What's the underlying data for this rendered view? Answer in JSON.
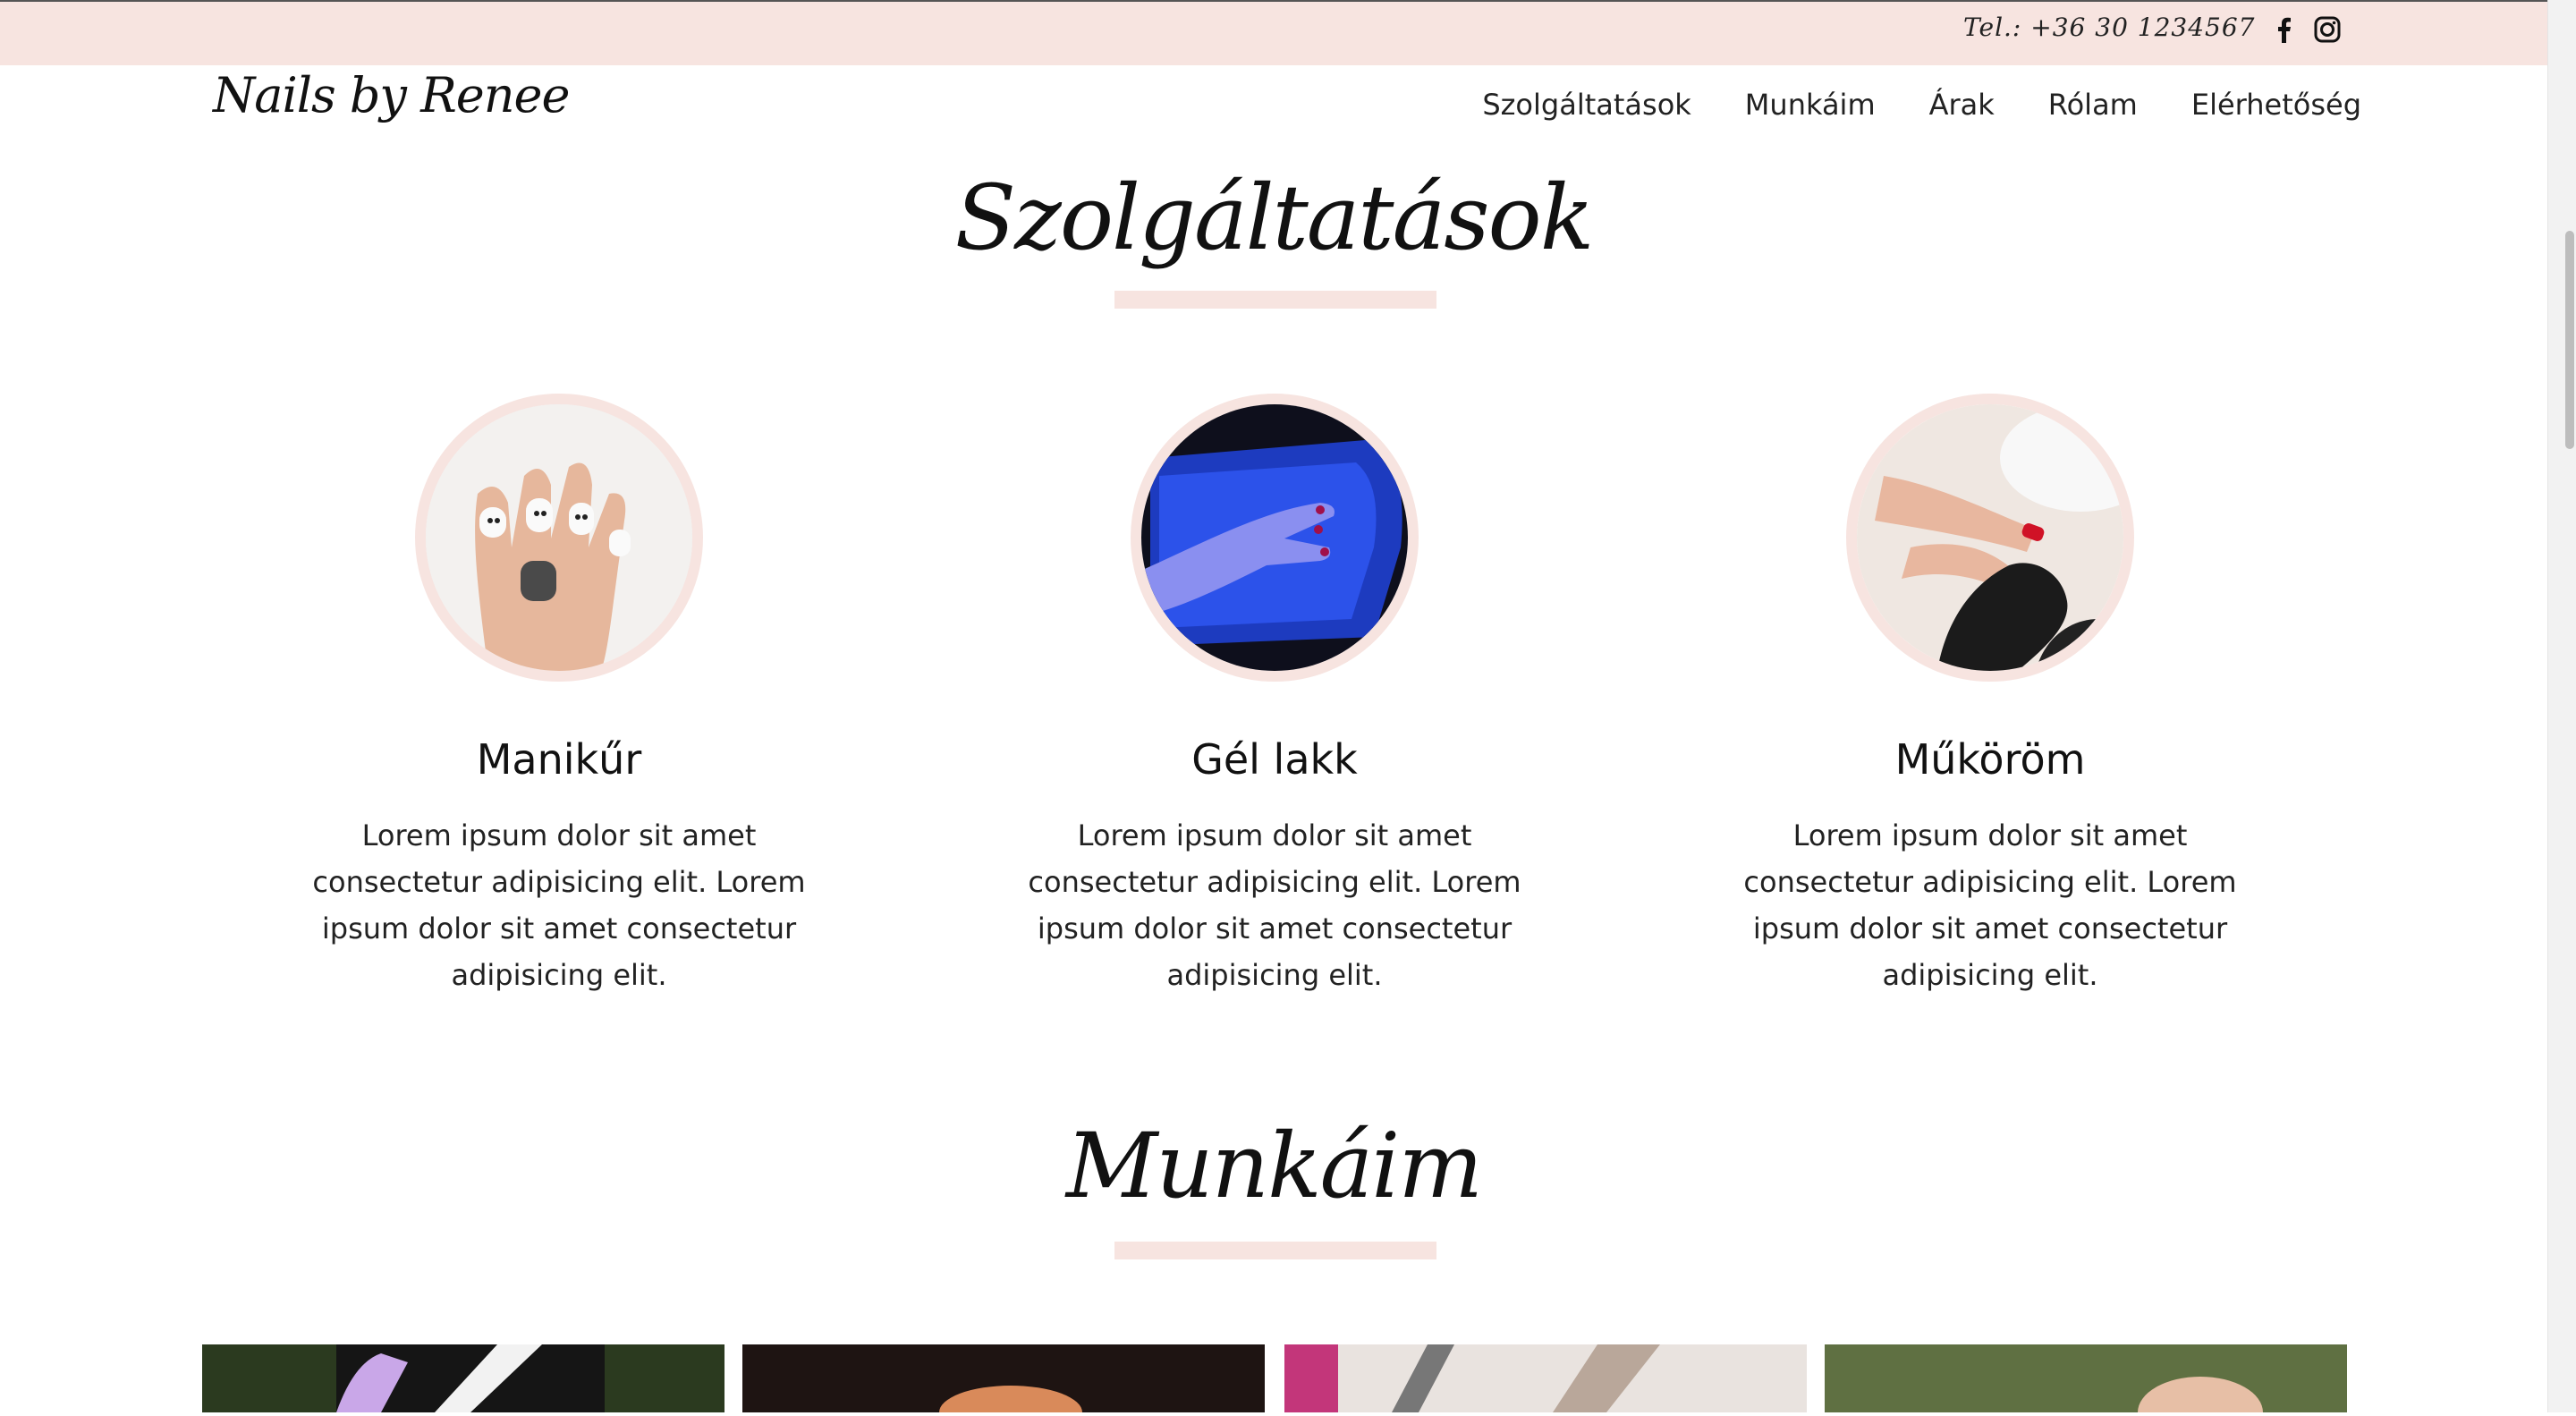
{
  "topbar": {
    "phone": "Tel.: +36 30 1234567",
    "facebook_icon": "facebook-icon",
    "instagram_icon": "instagram-icon"
  },
  "header": {
    "logo": "Nails by Renee",
    "nav": [
      "Szolgáltatások",
      "Munkáim",
      "Árak",
      "Rólam",
      "Elérhetőség"
    ]
  },
  "services_section": {
    "title": "Szolgáltatások",
    "items": [
      {
        "title": "Manikűr",
        "description": "Lorem ipsum dolor sit amet consectetur adipisicing elit. Lorem ipsum dolor sit amet consectetur adipisicing elit."
      },
      {
        "title": "Gél lakk",
        "description": "Lorem ipsum dolor sit amet consectetur adipisicing elit. Lorem ipsum dolor sit amet consectetur adipisicing elit."
      },
      {
        "title": "Műköröm",
        "description": "Lorem ipsum dolor sit amet consectetur adipisicing elit. Lorem ipsum dolor sit amet consectetur adipisicing elit."
      }
    ]
  },
  "works_section": {
    "title": "Munkáim"
  },
  "colors": {
    "accent_pink": "#f7e4e0",
    "text": "#111111"
  }
}
